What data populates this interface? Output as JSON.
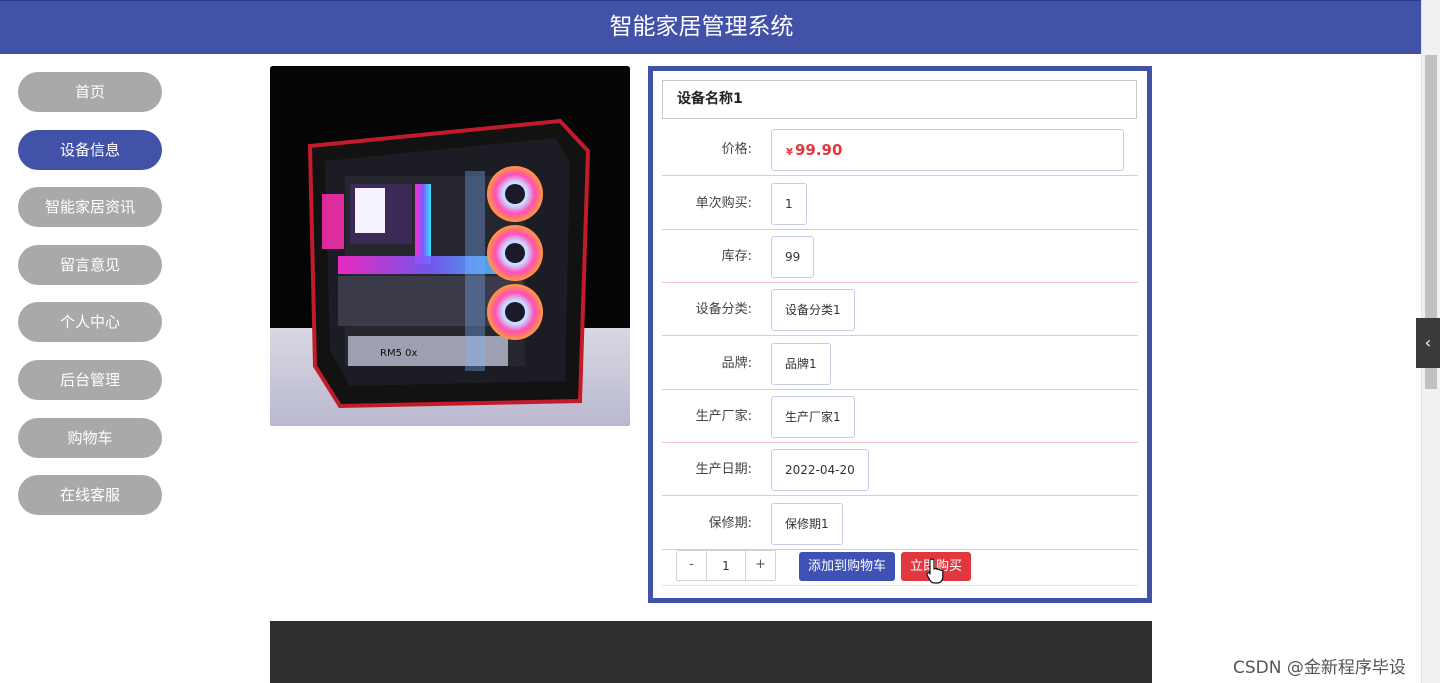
{
  "header": {
    "title": "智能家居管理系统"
  },
  "sidebar": {
    "items": [
      {
        "label": "首页"
      },
      {
        "label": "设备信息"
      },
      {
        "label": "智能家居资讯"
      },
      {
        "label": "留言意见"
      },
      {
        "label": "个人中心"
      },
      {
        "label": "后台管理"
      },
      {
        "label": "购物车"
      },
      {
        "label": "在线客服"
      }
    ]
  },
  "product": {
    "name": "设备名称1",
    "price_label": "价格:",
    "price_currency": "¥",
    "price_value": "99.90",
    "fields": [
      {
        "label": "单次购买:",
        "value": "1"
      },
      {
        "label": "库存:",
        "value": "99"
      },
      {
        "label": "设备分类:",
        "value": "设备分类1"
      },
      {
        "label": "品牌:",
        "value": "品牌1"
      },
      {
        "label": "生产厂家:",
        "value": "生产厂家1"
      },
      {
        "label": "生产日期:",
        "value": "2022-04-20"
      },
      {
        "label": "保修期:",
        "value": "保修期1"
      }
    ]
  },
  "actions": {
    "minus": "-",
    "quantity": "1",
    "plus": "+",
    "add_to_cart": "添加到购物车",
    "buy_now": "立即购买"
  },
  "watermark": "CSDN @金新程序毕设",
  "colors": {
    "primary": "#4252a8",
    "danger": "#e0383e",
    "nav_inactive": "#a9a9a9"
  },
  "icons": {
    "side_toggle": "chevron-left-icon",
    "cursor": "hand-pointer-icon"
  }
}
